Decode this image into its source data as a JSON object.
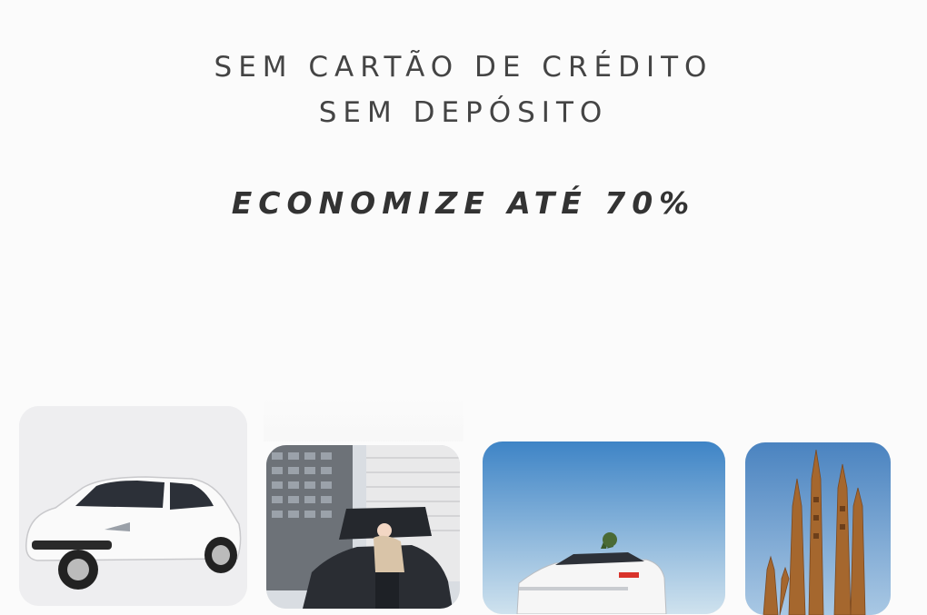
{
  "headline": {
    "line1": "SEM CARTÃO DE CRÉDITO",
    "line2": "SEM DEPÓSITO"
  },
  "promo": "ECONOMIZE ATÉ 70%",
  "cards": [
    {
      "image": "white-hatchback-car-image"
    },
    {
      "image": "person-loading-car-trunk-city-image"
    },
    {
      "image": "white-suv-blue-sky-image"
    },
    {
      "image": "sagrada-familia-barcelona-image"
    }
  ]
}
